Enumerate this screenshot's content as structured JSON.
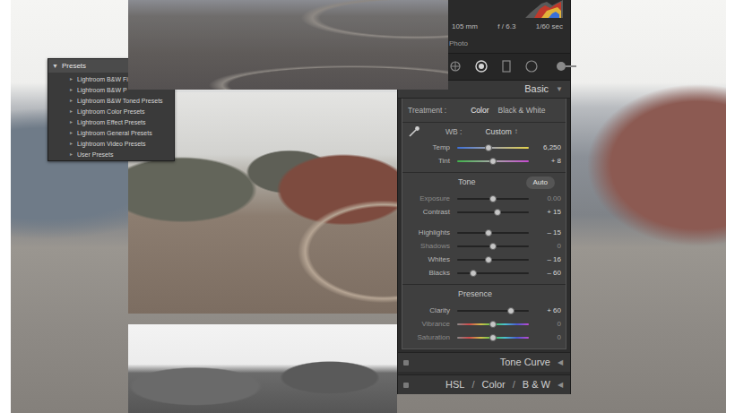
{
  "presets": {
    "title": "Presets",
    "toggle": "▼",
    "expanded": true,
    "items": [
      {
        "arrow": "►",
        "label": "Lightroom B&W Fi"
      },
      {
        "arrow": "►",
        "label": "Lightroom B&W P"
      },
      {
        "arrow": "►",
        "label": "Lightroom B&W Toned Presets"
      },
      {
        "arrow": "►",
        "label": "Lightroom Color Presets"
      },
      {
        "arrow": "►",
        "label": "Lightroom Effect Presets"
      },
      {
        "arrow": "►",
        "label": "Lightroom General Presets"
      },
      {
        "arrow": "►",
        "label": "Lightroom Video Presets"
      },
      {
        "arrow": "►",
        "label": "User Presets"
      }
    ]
  },
  "camera_info": {
    "focal_length": "105 mm",
    "aperture": "f / 6.3",
    "shutter": "1/60 sec",
    "mode": "Photo"
  },
  "basic": {
    "title": "Basic",
    "toggle": "▼",
    "expanded": true,
    "treatment": {
      "label": "Treatment :",
      "options": [
        {
          "label": "Color",
          "selected": true
        },
        {
          "label": "Black & White",
          "selected": false
        }
      ]
    },
    "wb": {
      "label": "WB :",
      "value": "Custom",
      "arrow": "↕",
      "sliders": [
        {
          "label": "Temp",
          "kind": "temp",
          "level": 0.44,
          "reading": "6,250",
          "dimmed": false
        },
        {
          "label": "Tint",
          "kind": "tint",
          "level": 0.5,
          "reading": "+ 8",
          "dimmed": false
        }
      ]
    },
    "tone": {
      "title": "Tone",
      "auto": "Auto",
      "groups": [
        [
          {
            "label": "Exposure",
            "kind": "plain",
            "level": 0.5,
            "reading": "0.00",
            "dimmed": true
          },
          {
            "label": "Contrast",
            "kind": "plain",
            "level": 0.56,
            "reading": "+ 15",
            "dimmed": false
          }
        ],
        [
          {
            "label": "Highlights",
            "kind": "plain",
            "level": 0.44,
            "reading": "– 15",
            "dimmed": false
          },
          {
            "label": "Shadows",
            "kind": "plain",
            "level": 0.5,
            "reading": "0",
            "dimmed": true
          },
          {
            "label": "Whites",
            "kind": "plain",
            "level": 0.44,
            "reading": "– 16",
            "dimmed": false
          },
          {
            "label": "Blacks",
            "kind": "plain",
            "level": 0.22,
            "reading": "– 60",
            "dimmed": false
          }
        ]
      ]
    },
    "presence": {
      "title": "Presence",
      "sliders": [
        {
          "label": "Clarity",
          "kind": "plain",
          "level": 0.75,
          "reading": "+ 60",
          "dimmed": false
        },
        {
          "label": "Vibrance",
          "kind": "rainbow",
          "level": 0.5,
          "reading": "0",
          "dimmed": true
        },
        {
          "label": "Saturation",
          "kind": "rainbow",
          "level": 0.5,
          "reading": "0",
          "dimmed": true
        }
      ]
    }
  },
  "tone_curve": {
    "label": "Tone Curve",
    "toggle": "◀",
    "expanded": false
  },
  "hsl_panel": {
    "tabs": [
      {
        "label": "HSL"
      },
      {
        "label": "Color"
      },
      {
        "label": "B & W"
      }
    ],
    "separator": "/",
    "toggle": "◀",
    "expanded": false
  }
}
